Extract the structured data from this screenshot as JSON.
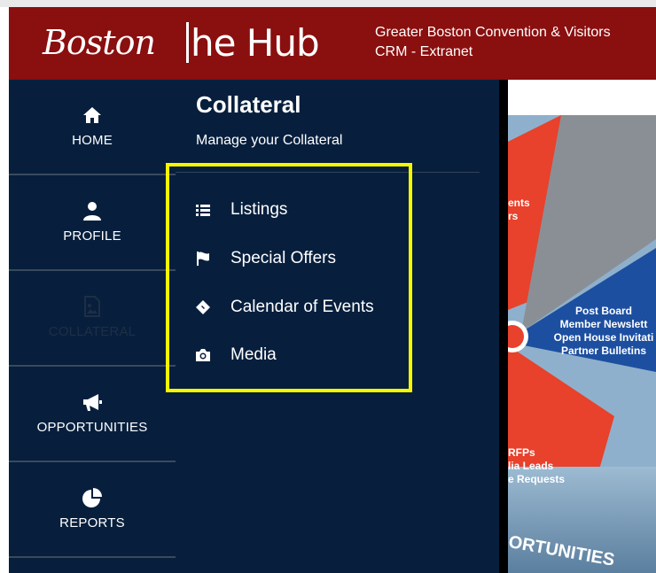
{
  "header": {
    "logo_left": "Boston",
    "logo_right": "he Hub",
    "line1": "Greater Boston Convention & Visitors",
    "line2": "CRM - Extranet"
  },
  "sidebar": {
    "items": [
      {
        "label": "HOME",
        "icon": "home-icon"
      },
      {
        "label": "PROFILE",
        "icon": "user-icon"
      },
      {
        "label": "COLLATERAL",
        "icon": "image-file-icon",
        "active": true
      },
      {
        "label": "OPPORTUNITIES",
        "icon": "megaphone-icon"
      },
      {
        "label": "REPORTS",
        "icon": "pie-chart-icon"
      }
    ]
  },
  "panel": {
    "title": "Collateral",
    "subtitle": "Manage your Collateral",
    "menu": [
      {
        "label": "Listings",
        "icon": "list-icon"
      },
      {
        "label": "Special Offers",
        "icon": "flag-icon"
      },
      {
        "label": "Calendar of Events",
        "icon": "ticket-icon"
      },
      {
        "label": "Media",
        "icon": "camera-icon"
      }
    ]
  },
  "background": {
    "upper_red_lines": [
      "ents",
      "rs"
    ],
    "blue_lines": [
      "Post Board",
      "Member Newslett",
      "Open House Invitati",
      "Partner Bulletins"
    ],
    "lower_red_lines": [
      "RFPs",
      "lia Leads",
      "e Requests"
    ],
    "bottom_word": "ORTUNITIES"
  },
  "colors": {
    "header_red": "#8a0f0f",
    "navy": "#071f3d",
    "highlight_yellow": "#f7f700",
    "wedge_red": "#e8412c",
    "wedge_blue": "#1d4fa0",
    "wedge_gray": "#8a8f96"
  }
}
